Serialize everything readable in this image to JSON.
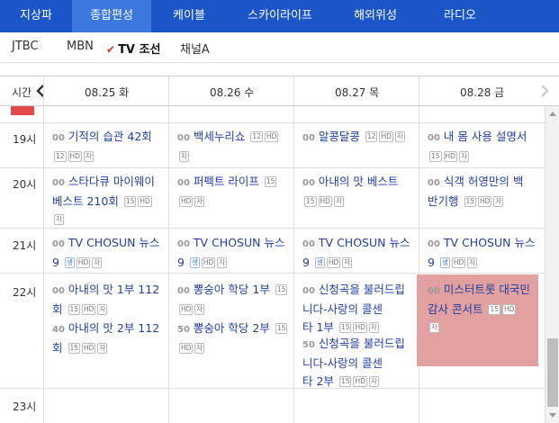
{
  "top_tabs": [
    {
      "label": "지상파"
    },
    {
      "label": "종합편성"
    },
    {
      "label": "케이블"
    },
    {
      "label": "스카이라이프"
    },
    {
      "label": "해외위성"
    },
    {
      "label": "라디오"
    }
  ],
  "sub_tabs": [
    {
      "label": "JTBC"
    },
    {
      "label": "MBN"
    },
    {
      "label": "TV 조선"
    },
    {
      "label": "채널A"
    }
  ],
  "header": {
    "time_label": "시간",
    "dates": [
      "08.25 화",
      "08.26 수",
      "08.27 목",
      "08.28 금"
    ]
  },
  "times": [
    "19시",
    "20시",
    "21시",
    "22시",
    "23시"
  ],
  "badges": {
    "age12": "12",
    "age15": "15",
    "hd": "HD",
    "sub": "자",
    "live": "생"
  },
  "programs": {
    "r19": [
      {
        "min": "00",
        "title": "기적의 습관 42회"
      },
      {
        "min": "00",
        "title": "백세누리쇼"
      },
      {
        "min": "00",
        "title": "알콩달콩"
      },
      {
        "min": "00",
        "title": "내 몸 사용 설명서"
      }
    ],
    "r20": [
      {
        "min": "00",
        "title_1": "스타다큐 마이웨이",
        "title_2": "베스트 210회"
      },
      {
        "min": "00",
        "title": "퍼펙트 라이프"
      },
      {
        "min": "00",
        "title": "아내의 맛 베스트"
      },
      {
        "min": "00",
        "title_1": "식객 허영만의 백",
        "title_2": "반기행"
      }
    ],
    "r21": [
      {
        "min": "00",
        "title_1": "TV CHOSUN 뉴스",
        "title_2": "9"
      },
      {
        "min": "00",
        "title_1": "TV CHOSUN 뉴스",
        "title_2": "9"
      },
      {
        "min": "00",
        "title_1": "TV CHOSUN 뉴스",
        "title_2": "9"
      },
      {
        "min": "00",
        "title_1": "TV CHOSUN 뉴스",
        "title_2": "9"
      }
    ],
    "r22": {
      "d1a": {
        "min": "00",
        "title_1": "아내의 맛 1부 112",
        "title_2": "회"
      },
      "d1b": {
        "min": "40",
        "title_1": "아내의 맛 2부 112",
        "title_2": "회"
      },
      "d2a": {
        "min": "00",
        "title": "뽕숭아 학당 1부"
      },
      "d2b": {
        "min": "50",
        "title": "뽕숭아 학당 2부"
      },
      "d3a": {
        "min": "00",
        "title_1": "신청곡을 불러드립",
        "title_2": "니다-사랑의 콜센",
        "title_3": "타 1부"
      },
      "d3b": {
        "min": "50",
        "title_1": "신청곡을 불러드립",
        "title_2": "니다-사랑의 콜센",
        "title_3": "타 2부"
      },
      "d4": {
        "min": "00",
        "title_1": "미스터트롯 대국민",
        "title_2": "감사 콘서트"
      }
    }
  },
  "colors": {
    "tab_bg": "#1a56c8",
    "tab_active": "#3c78de",
    "link": "#1f3fa3",
    "highlight": "#e3a0a0",
    "check": "#e0322b"
  }
}
